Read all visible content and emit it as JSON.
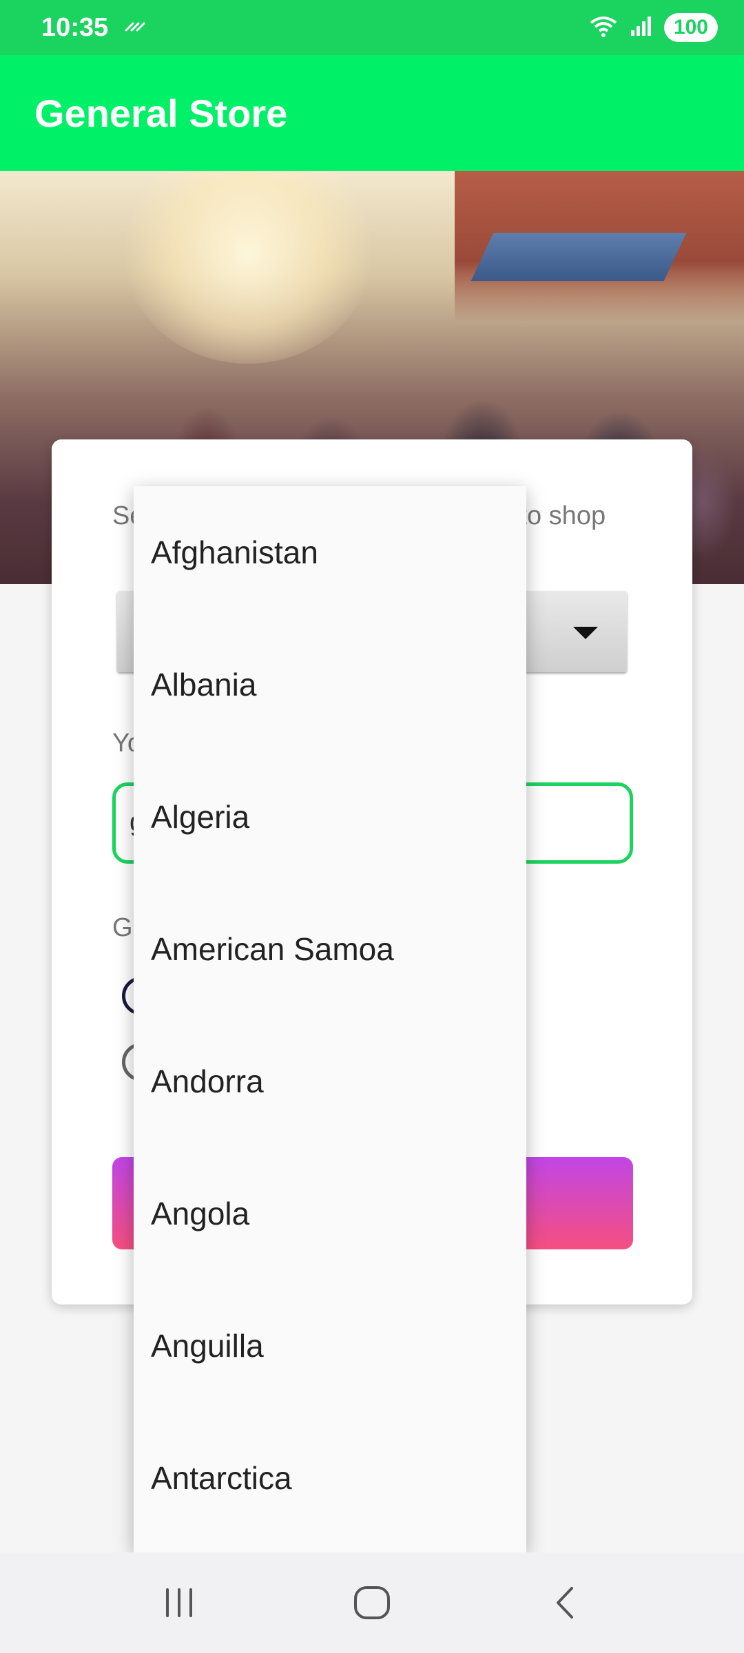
{
  "status_bar": {
    "time": "10:35",
    "battery": "100"
  },
  "app": {
    "title": "General Store"
  },
  "form": {
    "country_label": "Select the country where you want to shop",
    "name_label": "Your Name",
    "name_value": "g",
    "gender_label": "Gender",
    "selected_country": ""
  },
  "dropdown": {
    "items": [
      "Afghanistan",
      "Albania",
      "Algeria",
      "American Samoa",
      "Andorra",
      "Angola",
      "Anguilla",
      "Antarctica"
    ]
  },
  "colors": {
    "status_bar": "#1bd35f",
    "app_bar": "#00f068",
    "input_border": "#1bd35f",
    "button_gradient_top": "#c146e6",
    "button_gradient_bottom": "#f64f7f"
  },
  "icons": {
    "status_left": "wifi-calling-icon",
    "status_right": [
      "wifi-icon",
      "signal-icon",
      "battery-icon"
    ],
    "nav": [
      "recent-apps-icon",
      "home-icon",
      "back-icon"
    ]
  }
}
